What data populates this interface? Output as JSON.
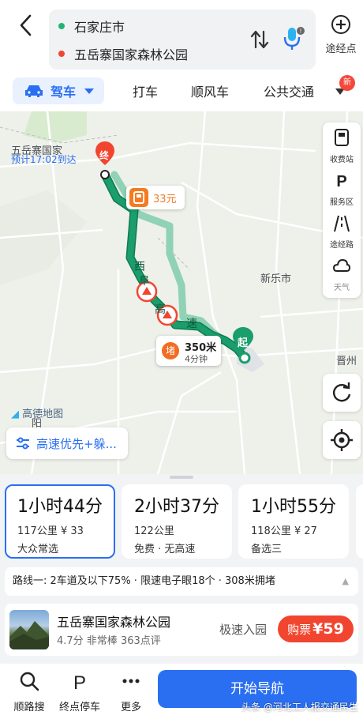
{
  "header": {
    "origin": "石家庄市",
    "destination": "五岳寨国家森林公园",
    "waypoint_label": "途经点",
    "colors": {
      "origin_dot": "#21b575",
      "destination_dot": "#f2452f"
    }
  },
  "modes": {
    "active": "驾车",
    "tabs": [
      "打车",
      "顺风车",
      "公共交通"
    ],
    "new_badge": "新"
  },
  "map": {
    "eta_text": "预计17:02到达",
    "dest_town": "五岳寨国家",
    "dest_marker": "终",
    "start_marker": "起",
    "toll": "33元",
    "jam_icon": "堵",
    "jam_distance": "350米",
    "jam_time": "4分钟",
    "city_label": "新乐市",
    "city_label_2": "晋州",
    "road_chars": [
      "西",
      "阜",
      "高",
      "速"
    ],
    "watermark": "高德地图",
    "watermark_sub": "阳",
    "tools": [
      "收费站",
      "服务区",
      "途经路",
      "天气"
    ],
    "preference": "高速优先+躲...",
    "colors": {
      "route_main": "#1a9e6b",
      "route_alt": "#8fd2b5"
    }
  },
  "routes": [
    {
      "duration": "1小时44分",
      "detail": "117公里  ¥ 33",
      "tag": "大众常选",
      "selected": true
    },
    {
      "duration": "2小时37分",
      "detail": "122公里",
      "tag": "免费 · 无高速",
      "selected": false
    },
    {
      "duration": "1小时55分",
      "detail": "118公里  ¥ 27",
      "tag": "备选三",
      "selected": false
    }
  ],
  "route_summary": "路线一:  2车道及以下75% · 限速电子眼18个 · 308米拥堵",
  "poi": {
    "name": "五岳寨国家森林公园",
    "meta": "4.7分  非常棒  363点评",
    "fast_entry": "极速入园",
    "buy_label": "购票",
    "price": "¥59"
  },
  "bottom": {
    "items": [
      "顺路搜",
      "终点停车",
      "更多"
    ],
    "start_nav": "开始导航"
  },
  "credit": "头条 @河北工人报交通民生"
}
